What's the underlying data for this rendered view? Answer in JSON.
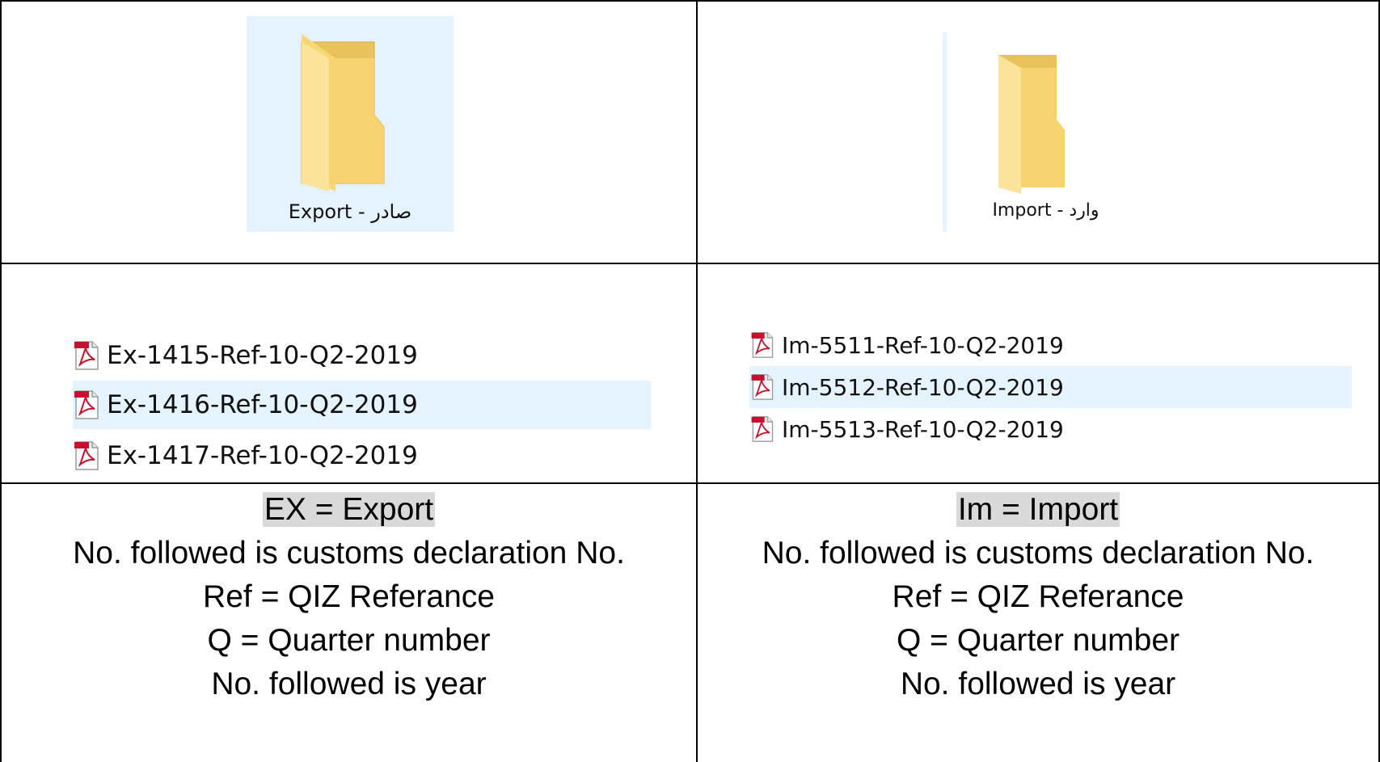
{
  "folders": {
    "export": {
      "label": "Export - صادر",
      "icon": "folder-icon"
    },
    "import": {
      "label": "Import - وارد",
      "icon": "folder-icon"
    }
  },
  "files": {
    "export": [
      {
        "name": "Ex-1415-Ref-10-Q2-2019",
        "icon": "pdf-file-icon",
        "selected": false
      },
      {
        "name": "Ex-1416-Ref-10-Q2-2019",
        "icon": "pdf-file-icon",
        "selected": true
      },
      {
        "name": "Ex-1417-Ref-10-Q2-2019",
        "icon": "pdf-file-icon",
        "selected": false
      }
    ],
    "import": [
      {
        "name": "Im-5511-Ref-10-Q2-2019",
        "icon": "pdf-file-icon",
        "selected": false
      },
      {
        "name": "Im-5512-Ref-10-Q2-2019",
        "icon": "pdf-file-icon",
        "selected": true
      },
      {
        "name": "Im-5513-Ref-10-Q2-2019",
        "icon": "pdf-file-icon",
        "selected": false
      }
    ]
  },
  "legend": {
    "export": [
      "EX = Export",
      "No. followed is customs declaration No.",
      "Ref = QIZ Referance",
      "Q = Quarter number",
      "No. followed is year"
    ],
    "import": [
      "Im = Import",
      "No. followed is customs declaration No.",
      "Ref = QIZ Referance",
      "Q = Quarter number",
      "No. followed is year"
    ]
  },
  "colors": {
    "selection": "#e5f3ff",
    "highlight": "#d9d9d9",
    "folder_front": "#f8d775",
    "folder_back": "#e8c25a",
    "pdf_red": "#c8102e"
  }
}
